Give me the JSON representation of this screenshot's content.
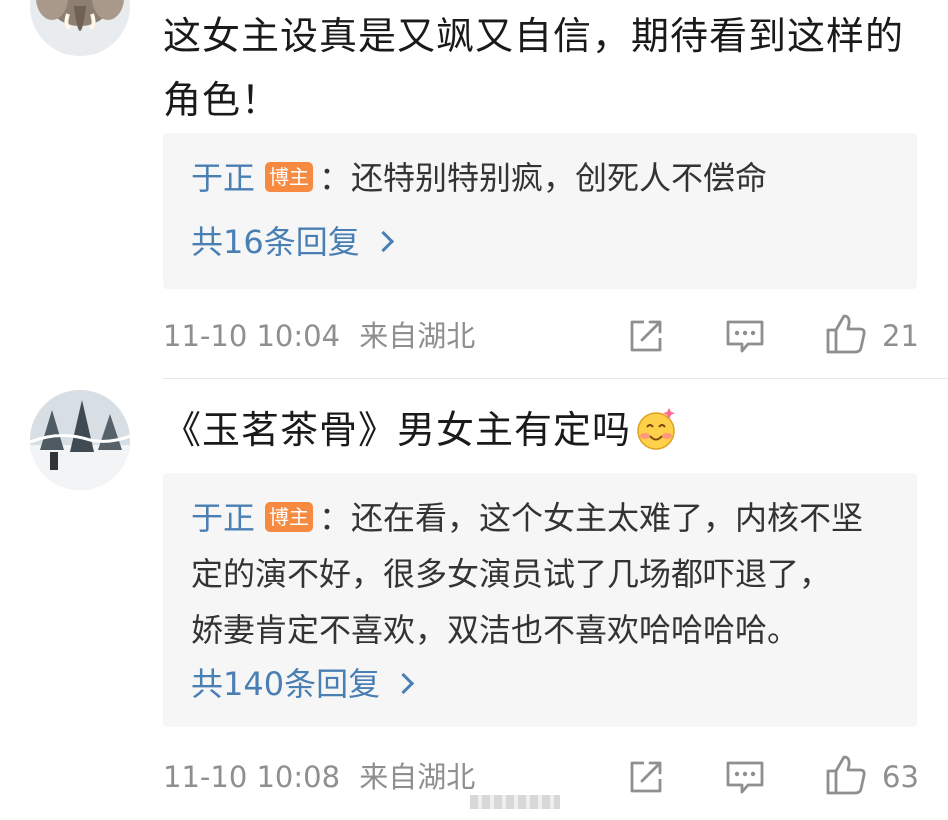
{
  "comments": [
    {
      "text_line1": "这女主设真是又飒又自信，期待看到这样的",
      "text_line2": "角色！",
      "avatar_icon": "elephant-avatar",
      "reply": {
        "author": "于正",
        "badge": "博主",
        "text": "：还特别特别疯，创死人不偿命",
        "count_label": "共16条回复"
      },
      "timestamp": "11-10 10:04",
      "location": "来自湖北",
      "likes": "21"
    },
    {
      "text": "《玉茗茶骨》男女主有定吗",
      "emoji_icon": "blush-smile-emoji",
      "avatar_icon": "snowy-tree-avatar",
      "reply": {
        "author": "于正",
        "badge": "博主",
        "text_line1": "：还在看，这个女主太难了，内核不坚",
        "text_line2": "定的演不好，很多女演员试了几场都吓退了，",
        "text_line3": "娇妻肯定不喜欢，双洁也不喜欢哈哈哈哈。",
        "count_label": "共140条回复"
      },
      "timestamp": "11-10 10:08",
      "location": "来自湖北",
      "likes": "63"
    }
  ],
  "colors": {
    "link_blue": "#4a7fb4",
    "badge_orange": "#f68a40",
    "meta_gray": "#8f8f8f",
    "reply_bg": "#f6f6f6"
  }
}
